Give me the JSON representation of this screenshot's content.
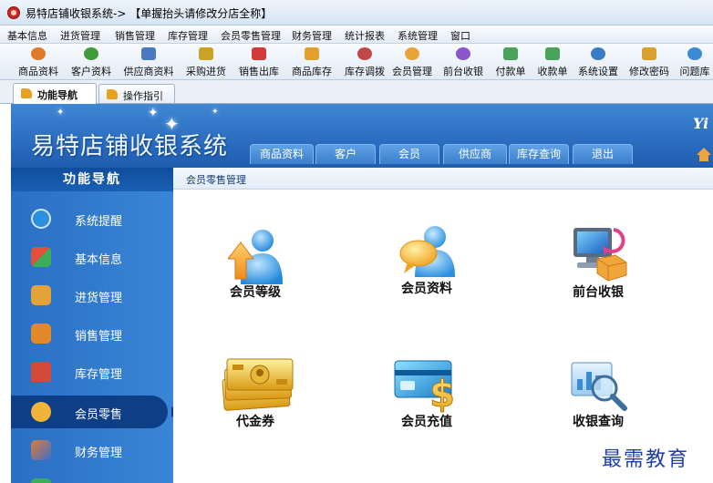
{
  "window": {
    "title": "易特店铺收银系统-> 【单握抬头请修改分店全称】"
  },
  "menubar": [
    "基本信息",
    "进货管理",
    "销售管理",
    "库存管理",
    "会员零售管理",
    "财务管理",
    "统计报表",
    "系统管理",
    "窗口"
  ],
  "toolbar": [
    {
      "label": "商品资料",
      "icon": "product-icon",
      "color": "#e07a2a"
    },
    {
      "label": "客户资料",
      "icon": "customer-icon",
      "color": "#3f9a3a"
    },
    {
      "label": "供应商资料",
      "icon": "supplier-icon",
      "color": "#4a79c4"
    },
    {
      "label": "采购进货",
      "icon": "purchase-icon",
      "color": "#c9a227"
    },
    {
      "label": "销售出库",
      "icon": "sales-icon",
      "color": "#d23b3b"
    },
    {
      "label": "商品库存",
      "icon": "stock-icon",
      "color": "#e2a02f"
    },
    {
      "label": "库存调拨",
      "icon": "transfer-icon",
      "color": "#c04848"
    },
    {
      "label": "会员管理",
      "icon": "member-icon",
      "color": "#e8a33a"
    },
    {
      "label": "前台收银",
      "icon": "cashier-icon",
      "color": "#8a56c9"
    },
    {
      "label": "付款单",
      "icon": "payment-icon",
      "color": "#4aa35a"
    },
    {
      "label": "收款单",
      "icon": "receipt-icon",
      "color": "#4aa35a"
    },
    {
      "label": "系统设置",
      "icon": "settings-icon",
      "color": "#3a7bc8"
    },
    {
      "label": "修改密码",
      "icon": "password-icon",
      "color": "#d9a12e"
    },
    {
      "label": "问题库",
      "icon": "help-icon",
      "color": "#3a8ad6"
    }
  ],
  "tabs": [
    {
      "label": "功能导航",
      "active": true
    },
    {
      "label": "操作指引",
      "active": false
    }
  ],
  "banner": {
    "app_name": "易特店铺收银系统",
    "brand_mark": "Yi",
    "tabs": [
      "商品资料",
      "客户",
      "会员",
      "供应商",
      "库存查询",
      "退出"
    ]
  },
  "sidebar": {
    "header": "功能导航",
    "items": [
      {
        "label": "系统提醒",
        "icon": "info-icon",
        "color": "#2d8fe0"
      },
      {
        "label": "基本信息",
        "icon": "blocks-icon",
        "color": "#e0503a"
      },
      {
        "label": "进货管理",
        "icon": "box-in-icon",
        "color": "#e2a33a"
      },
      {
        "label": "销售管理",
        "icon": "box-out-icon",
        "color": "#e28a2a"
      },
      {
        "label": "库存管理",
        "icon": "warehouse-icon",
        "color": "#d24a3a"
      },
      {
        "label": "会员零售",
        "icon": "member-icon",
        "color": "#f0b43a"
      },
      {
        "label": "财务管理",
        "icon": "finance-icon",
        "color": "#e07a3a"
      }
    ],
    "active_index": 5
  },
  "breadcrumb": "会员零售管理",
  "tiles": [
    {
      "label": "会员等级",
      "icon": "member-level-icon"
    },
    {
      "label": "会员资料",
      "icon": "member-info-icon"
    },
    {
      "label": "前台收银",
      "icon": "cashier-pc-icon"
    },
    {
      "label": "代金券",
      "icon": "voucher-icon"
    },
    {
      "label": "会员充值",
      "icon": "recharge-card-icon"
    },
    {
      "label": "收银查询",
      "icon": "cash-query-icon"
    }
  ],
  "watermark": "最需教育"
}
